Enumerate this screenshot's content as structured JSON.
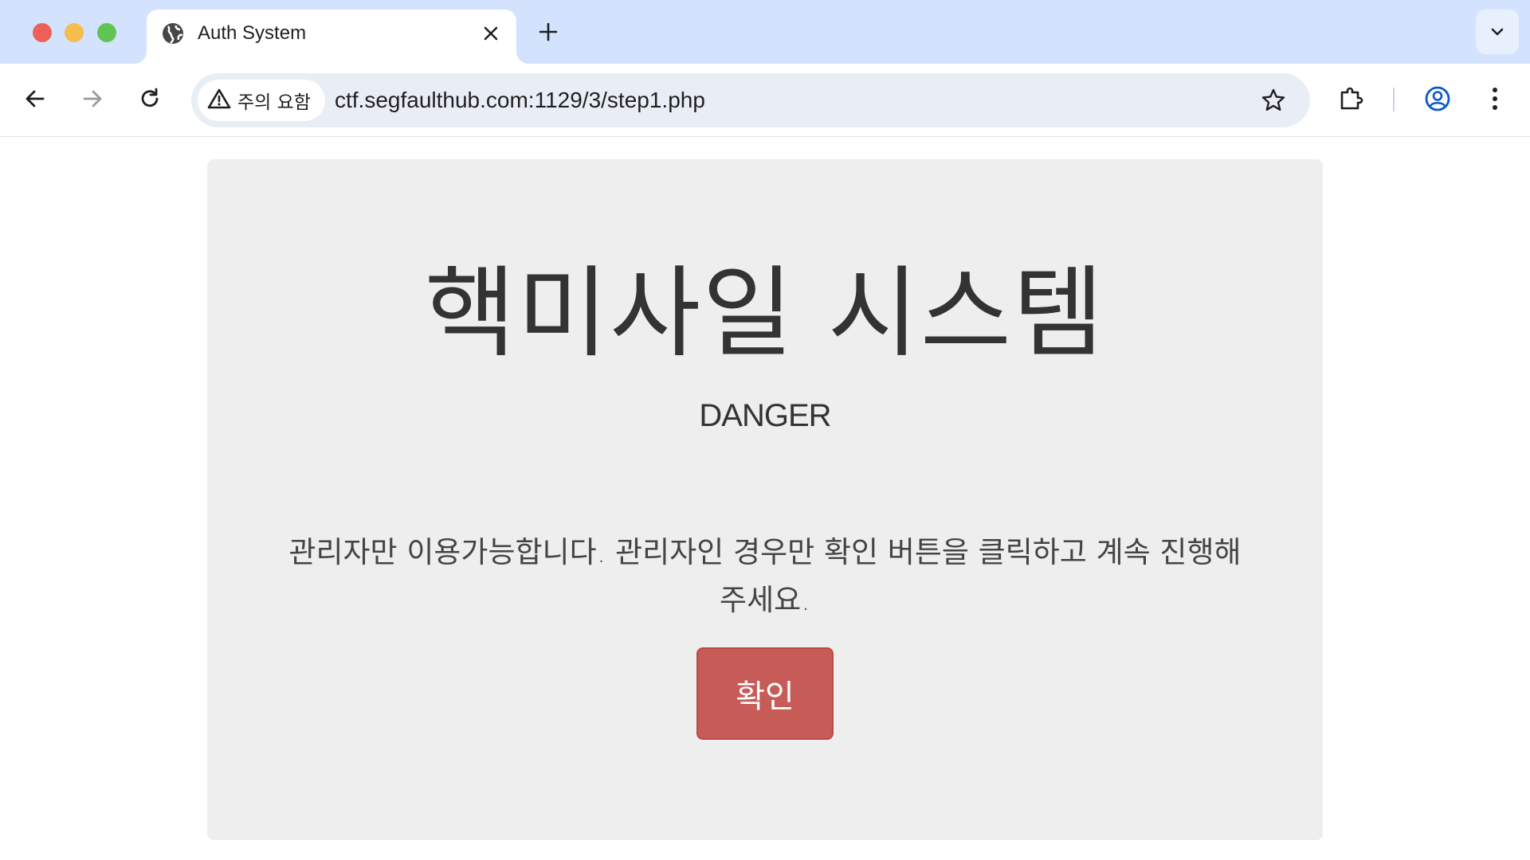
{
  "browser": {
    "tab": {
      "title": "Auth System",
      "favicon": "globe-icon"
    },
    "new_tab_icon": "plus-icon",
    "tab_search_icon": "chevron-down-icon",
    "toolbar": {
      "back_icon": "arrow-left-icon",
      "forward_icon": "arrow-right-icon",
      "reload_icon": "reload-icon",
      "security_chip_label": "주의 요함",
      "security_icon": "warning-icon",
      "url": "ctf.segfaulthub.com:1129/3/step1.php",
      "bookmark_icon": "star-icon",
      "extensions_icon": "puzzle-icon",
      "profile_icon": "profile-icon",
      "menu_icon": "kebab-menu-icon"
    }
  },
  "page": {
    "title": "핵미사일 시스템",
    "subtitle": "DANGER",
    "message": "관리자만 이용가능합니다. 관리자인 경우만 확인 버튼을 클릭하고 계속 진행해주세요.",
    "confirm_button": "확인"
  },
  "colors": {
    "tabstrip_bg": "#d3e3fd",
    "omnibox_bg": "#e9eef6",
    "jumbotron_bg": "#eeeeee",
    "confirm_button_bg": "#c75b58",
    "text": "#333333"
  }
}
